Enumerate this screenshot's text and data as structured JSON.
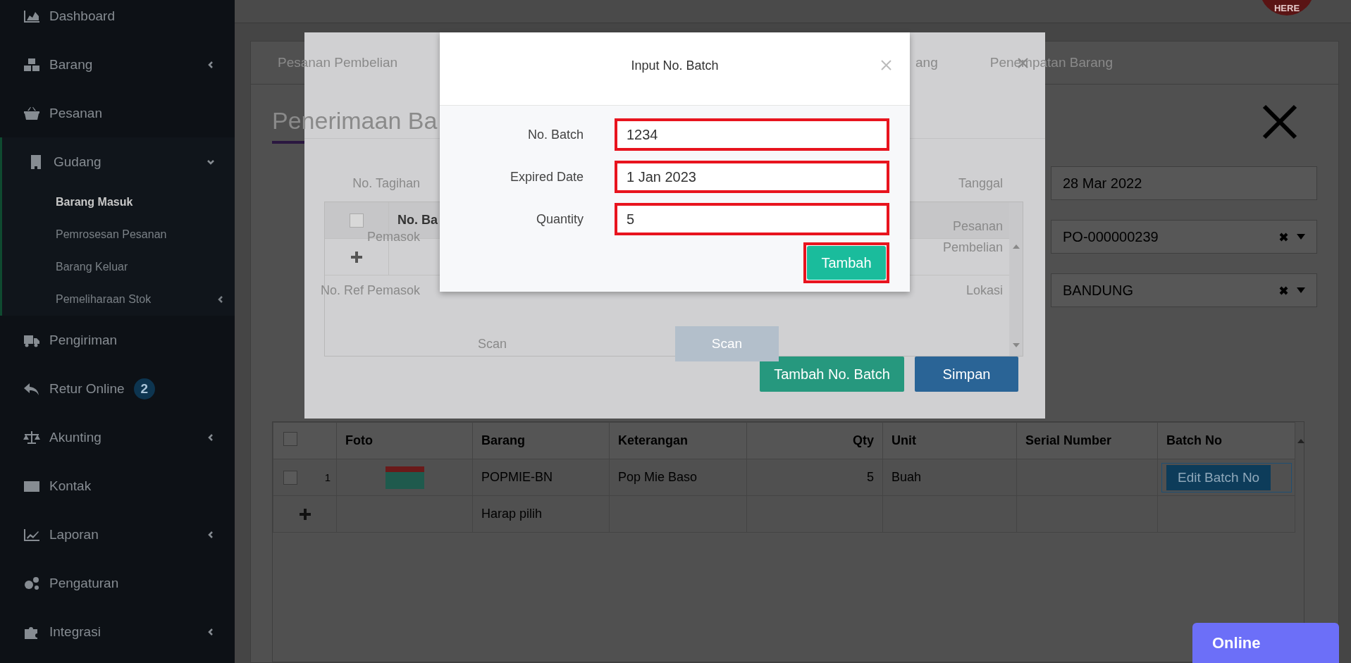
{
  "header": {
    "logo_text": "HERE"
  },
  "sidebar": {
    "items": [
      {
        "label": "Dashboard",
        "selected": false
      },
      {
        "label": "Barang",
        "selected": false,
        "expanded": false
      },
      {
        "label": "Pesanan",
        "selected": false
      },
      {
        "label": "Gudang",
        "selected": false,
        "expanded": true,
        "children": [
          {
            "label": "Barang Masuk",
            "selected": true
          },
          {
            "label": "Pemrosesan Pesanan",
            "selected": false
          },
          {
            "label": "Barang Keluar",
            "selected": false
          },
          {
            "label": "Pemeliharaan Stok",
            "selected": false,
            "expanded": false
          }
        ]
      },
      {
        "label": "Pengiriman",
        "selected": false
      },
      {
        "label": "Retur Online",
        "selected": false,
        "badge": "2"
      },
      {
        "label": "Akunting",
        "selected": false,
        "expanded": false
      },
      {
        "label": "Kontak",
        "selected": false
      },
      {
        "label": "Laporan",
        "selected": false,
        "expanded": false
      },
      {
        "label": "Pengaturan",
        "selected": false
      },
      {
        "label": "Integrasi",
        "selected": false,
        "expanded": false
      }
    ]
  },
  "tabs": [
    {
      "label": "Pesanan Pembelian",
      "selected": false
    },
    {
      "label": "ang",
      "selected": false
    },
    {
      "label": "Penempatan Barang",
      "selected": false
    }
  ],
  "page": {
    "title": "Penerimaan Ba",
    "form": {
      "left": [
        {
          "label": "No. Tagihan"
        },
        {
          "label": "Pemasok"
        },
        {
          "label": "No. Ref Pemasok"
        }
      ],
      "right": [
        {
          "label": "Tanggal",
          "value": "28 Mar 2022",
          "kind": "text"
        },
        {
          "label": "Pesanan Pembelian",
          "value": "PO-000000239",
          "kind": "select"
        },
        {
          "label": "Lokasi",
          "value": "BANDUNG",
          "kind": "select"
        }
      ],
      "scan": {
        "placeholder": "Scan",
        "button": "Scan"
      }
    }
  },
  "items_table": {
    "header_checkbox": {
      "checked": false
    },
    "columns": [
      "Foto",
      "Barang",
      "Keterangan",
      "Qty",
      "Unit",
      "Serial Number",
      "Batch No"
    ],
    "rows": [
      {
        "number": "1",
        "checked": false,
        "barang": "POPMIE-BN",
        "keterangan": "Pop Mie Baso",
        "qty": "5",
        "unit": "Buah",
        "action": "Edit Batch No"
      }
    ],
    "new_row": {
      "placeholder": "Harap pilih"
    }
  },
  "batch_modal": {
    "header_checkbox": {
      "checked": false
    },
    "columns": [
      "No. Ba"
    ],
    "buttons": [
      {
        "label": "Tambah No. Batch",
        "kind": "success"
      },
      {
        "label": "Simpan",
        "kind": "primary"
      }
    ]
  },
  "input_modal": {
    "title": "Input No. Batch",
    "fields": [
      {
        "label": "No. Batch",
        "value": "1234",
        "highlighted": true
      },
      {
        "label": "Expired Date",
        "value": "1 Jan 2023",
        "highlighted": true
      },
      {
        "label": "Quantity",
        "value": "5",
        "highlighted": true
      }
    ],
    "button": {
      "label": "Tambah",
      "highlighted": true
    }
  },
  "status": {
    "label": "Online"
  }
}
